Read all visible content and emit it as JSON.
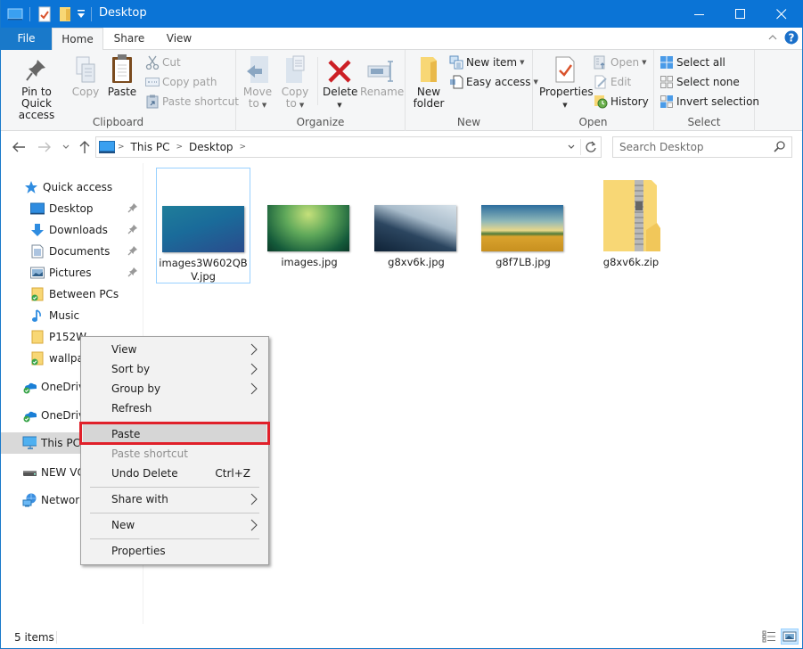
{
  "window": {
    "title": "Desktop",
    "controls": {
      "minimize": "minimize",
      "maximize": "maximize",
      "close": "close"
    }
  },
  "ribbon_tabs": [
    {
      "label": "File"
    },
    {
      "label": "Home"
    },
    {
      "label": "Share"
    },
    {
      "label": "View"
    }
  ],
  "ribbon": {
    "clipboard": {
      "label": "Clipboard",
      "pin_line1": "Pin to Quick",
      "pin_line2": "access",
      "copy": "Copy",
      "paste": "Paste",
      "cut": "Cut",
      "copy_path": "Copy path",
      "paste_shortcut": "Paste shortcut"
    },
    "organize": {
      "label": "Organize",
      "move_line1": "Move",
      "move_line2": "to",
      "copy_line1": "Copy",
      "copy_line2": "to",
      "delete": "Delete",
      "rename": "Rename"
    },
    "new": {
      "label": "New",
      "new_folder_line1": "New",
      "new_folder_line2": "folder",
      "new_item": "New item",
      "easy_access": "Easy access"
    },
    "open": {
      "label": "Open",
      "properties": "Properties",
      "open": "Open",
      "edit": "Edit",
      "history": "History"
    },
    "select": {
      "label": "Select",
      "select_all": "Select all",
      "select_none": "Select none",
      "invert": "Invert selection"
    }
  },
  "address": {
    "breadcrumbs": [
      "This PC",
      "Desktop"
    ],
    "search_placeholder": "Search Desktop"
  },
  "sidebar": {
    "items": [
      {
        "label": "Quick access",
        "icon": "star-icon"
      },
      {
        "label": "Desktop",
        "icon": "desktop-icon",
        "pinned": true
      },
      {
        "label": "Downloads",
        "icon": "download-icon",
        "pinned": true
      },
      {
        "label": "Documents",
        "icon": "document-icon",
        "pinned": true
      },
      {
        "label": "Pictures",
        "icon": "pictures-icon",
        "pinned": true
      },
      {
        "label": "Between PCs",
        "icon": "synced-folder-icon"
      },
      {
        "label": "Music",
        "icon": "music-icon"
      },
      {
        "label": "P152W",
        "icon": "folder-icon"
      },
      {
        "label": "wallpa",
        "icon": "synced-folder-icon"
      },
      {
        "label": "OneDriv",
        "icon": "onedrive-icon"
      },
      {
        "label": "OneDriv",
        "icon": "onedrive-icon"
      },
      {
        "label": "This PC",
        "icon": "computer-icon",
        "selected": true
      },
      {
        "label": "NEW VC",
        "icon": "drive-icon"
      },
      {
        "label": "Network",
        "icon": "network-icon"
      }
    ]
  },
  "files": [
    {
      "name": "images3W602QBV.jpg",
      "type": "image",
      "selected": true
    },
    {
      "name": "images.jpg",
      "type": "image"
    },
    {
      "name": "g8xv6k.jpg",
      "type": "image"
    },
    {
      "name": "g8f7LB.jpg",
      "type": "image"
    },
    {
      "name": "g8xv6k.zip",
      "type": "zip"
    }
  ],
  "context_menu": {
    "items": [
      {
        "label": "View",
        "submenu": true
      },
      {
        "label": "Sort by",
        "submenu": true
      },
      {
        "label": "Group by",
        "submenu": true
      },
      {
        "label": "Refresh"
      },
      {
        "label": "Paste",
        "highlighted": true
      },
      {
        "label": "Paste shortcut",
        "disabled": true
      },
      {
        "label": "Undo Delete",
        "shortcut": "Ctrl+Z"
      },
      {
        "label": "Share with",
        "submenu": true
      },
      {
        "label": "New",
        "submenu": true
      },
      {
        "label": "Properties"
      }
    ],
    "highlight_color": "#e0202a"
  },
  "status": {
    "item_count": "5 items"
  },
  "colors": {
    "accent": "#0b74d6",
    "file_tab": "#1979ca",
    "selection_border": "#99d1ff"
  }
}
